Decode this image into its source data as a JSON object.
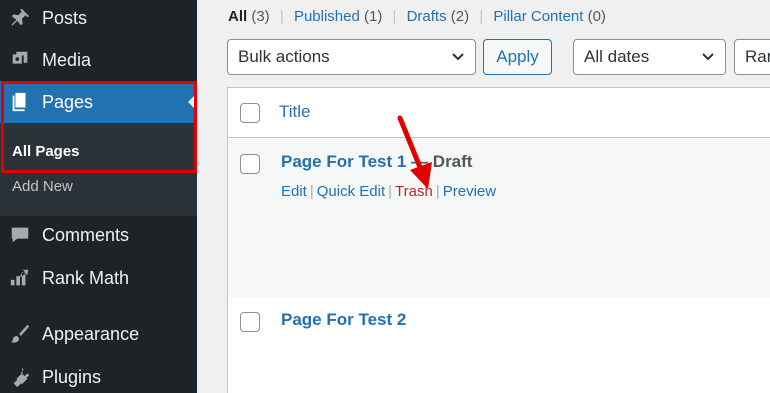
{
  "sidebar": {
    "items": [
      {
        "label": "Posts",
        "icon": "pin-icon"
      },
      {
        "label": "Media",
        "icon": "media-icon"
      },
      {
        "label": "Pages",
        "icon": "pages-icon"
      },
      {
        "label": "Comments",
        "icon": "comment-icon"
      },
      {
        "label": "Rank Math",
        "icon": "rank-math-icon"
      },
      {
        "label": "Appearance",
        "icon": "brush-icon"
      },
      {
        "label": "Plugins",
        "icon": "plugin-icon"
      }
    ],
    "submenu": {
      "all_pages": "All Pages",
      "add_new": "Add New"
    },
    "highlight_color": "#e00000",
    "active_color": "#2271b1"
  },
  "filters": {
    "all": {
      "label": "All",
      "count": "(3)"
    },
    "published": {
      "label": "Published",
      "count": "(1)"
    },
    "drafts": {
      "label": "Drafts",
      "count": "(2)"
    },
    "pillar": {
      "label": "Pillar Content",
      "count": "(0)"
    }
  },
  "toolbar": {
    "bulk_actions": "Bulk actions",
    "apply": "Apply",
    "dates": "All dates",
    "rank": "Ran"
  },
  "table": {
    "header_title": "Title",
    "rows": [
      {
        "title": "Page For Test 1",
        "state": " — Draft",
        "actions": {
          "edit": "Edit",
          "quick_edit": "Quick Edit",
          "trash": "Trash",
          "preview": "Preview"
        }
      },
      {
        "title": "Page For Test 2"
      }
    ]
  },
  "annotation": {
    "arrow_color": "#e00000"
  }
}
